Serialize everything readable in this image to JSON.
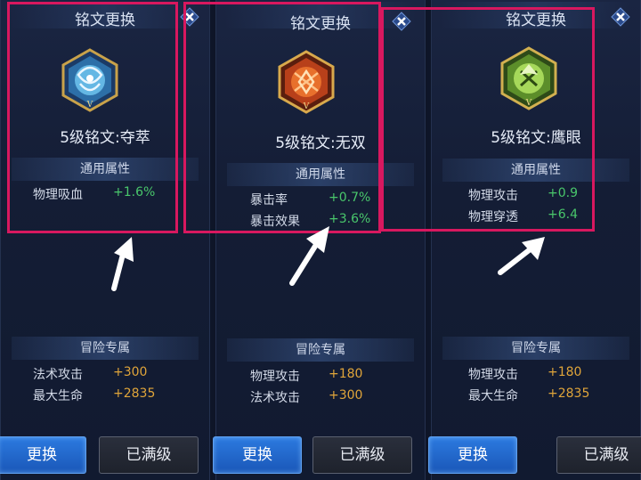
{
  "panels": [
    {
      "title": "铭文更换",
      "rune_name": "5级铭文:夺萃",
      "general_label": "通用属性",
      "general_stats": [
        {
          "name": "物理吸血",
          "value": "+1.6%"
        }
      ],
      "adventure_label": "冒险专属",
      "adventure_stats": [
        {
          "name": "法术攻击",
          "value": "+300"
        },
        {
          "name": "最大生命",
          "value": "+2835"
        }
      ],
      "replace_label": "更换",
      "maxed_label": "已满级",
      "emblem_color": "#4aa7d8"
    },
    {
      "title": "铭文更换",
      "rune_name": "5级铭文:无双",
      "general_label": "通用属性",
      "general_stats": [
        {
          "name": "暴击率",
          "value": "+0.7%"
        },
        {
          "name": "暴击效果",
          "value": "+3.6%"
        }
      ],
      "adventure_label": "冒险专属",
      "adventure_stats": [
        {
          "name": "物理攻击",
          "value": "+180"
        },
        {
          "name": "法术攻击",
          "value": "+300"
        }
      ],
      "replace_label": "更换",
      "maxed_label": "已满级",
      "emblem_color": "#d9531f"
    },
    {
      "title": "铭文更换",
      "rune_name": "5级铭文:鹰眼",
      "general_label": "通用属性",
      "general_stats": [
        {
          "name": "物理攻击",
          "value": "+0.9"
        },
        {
          "name": "物理穿透",
          "value": "+6.4"
        }
      ],
      "adventure_label": "冒险专属",
      "adventure_stats": [
        {
          "name": "物理攻击",
          "value": "+180"
        },
        {
          "name": "最大生命",
          "value": "+2835"
        }
      ],
      "replace_label": "更换",
      "maxed_label": "已满级",
      "emblem_color": "#7fbf3a"
    }
  ],
  "colors": {
    "highlight": "#d8185f",
    "stat_green": "#49c76b",
    "stat_orange": "#e0a53a"
  },
  "icons": [
    "close-icon",
    "up-arrow-icon",
    "rune-emblem-icon"
  ]
}
